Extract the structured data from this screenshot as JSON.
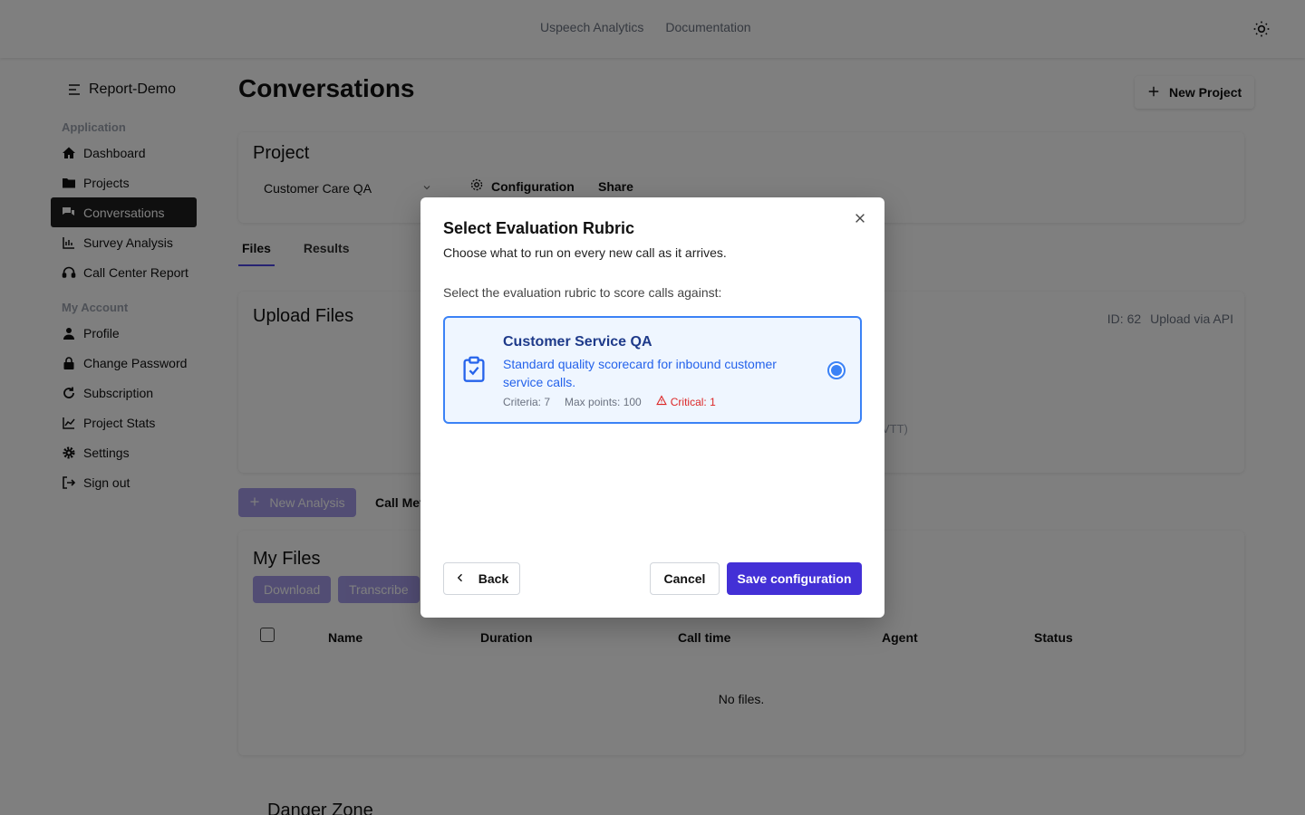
{
  "topnav": {
    "links": [
      "Uspeech Analytics",
      "Documentation"
    ],
    "theme_icon": "sun-icon"
  },
  "sidebar": {
    "brand": "Report-Demo",
    "sections": [
      {
        "title": "Application",
        "items": [
          {
            "label": "Dashboard",
            "icon": "home-icon"
          },
          {
            "label": "Projects",
            "icon": "folder-icon"
          },
          {
            "label": "Conversations",
            "icon": "chat-icon",
            "active": true
          },
          {
            "label": "Survey Analysis",
            "icon": "chart-bar-icon"
          },
          {
            "label": "Call Center Report",
            "icon": "headset-icon"
          }
        ]
      },
      {
        "title": "My Account",
        "items": [
          {
            "label": "Profile",
            "icon": "user-icon"
          },
          {
            "label": "Change Password",
            "icon": "lock-icon"
          },
          {
            "label": "Subscription",
            "icon": "refresh-icon"
          },
          {
            "label": "Project Stats",
            "icon": "line-chart-icon"
          },
          {
            "label": "Settings",
            "icon": "gear-icon"
          },
          {
            "label": "Sign out",
            "icon": "sign-out-icon"
          }
        ]
      }
    ]
  },
  "main": {
    "title": "Conversations",
    "new_project": "New Project",
    "project_label": "Project",
    "project_selected": "Customer Care QA",
    "configuration": "Configuration",
    "share": "Share",
    "tabs": [
      {
        "label": "Files",
        "active": true
      },
      {
        "label": "Results"
      }
    ],
    "upload_title": "Upload Files",
    "upload_id": "ID: 62",
    "upload_api": "Upload via API",
    "upload_hint": "VTT)",
    "new_analysis": "New Analysis",
    "call_metrics": "Call Met",
    "files_title": "My Files",
    "download": "Download",
    "transcribe": "Transcribe",
    "columns": [
      "Name",
      "Duration",
      "Call time",
      "Agent",
      "Status"
    ],
    "empty": "No files.",
    "danger_zone": "Danger Zone"
  },
  "modal": {
    "title": "Select Evaluation Rubric",
    "subtitle": "Choose what to run on every new call as it arrives.",
    "prompt": "Select the evaluation rubric to score calls against:",
    "rubric": {
      "name": "Customer Service QA",
      "description": "Standard quality scorecard for inbound customer service calls.",
      "criteria": "Criteria: 7",
      "max_points": "Max points: 100",
      "critical": "Critical: 1",
      "selected": true
    },
    "back": "Back",
    "cancel": "Cancel",
    "save": "Save configuration"
  }
}
